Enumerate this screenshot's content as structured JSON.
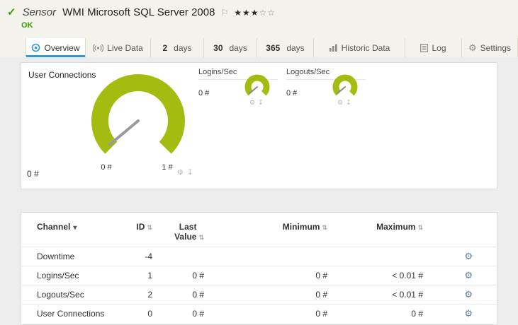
{
  "colors": {
    "gauge_green": "#a3bc0f",
    "needle_gray": "#999999",
    "tab_accent_blue": "#2d9bd8",
    "ok_green": "#30a000"
  },
  "icons": {
    "check": "✓",
    "flag": "⚐",
    "gear": "⚙",
    "download": "↧",
    "dropdown": "▾",
    "sort": "⇅",
    "channel_settings": "⚙"
  },
  "header": {
    "kind_label": "Sensor",
    "title": "WMI Microsoft SQL Server 2008",
    "stars_filled": "★★★",
    "stars_empty": "☆☆",
    "status": "OK"
  },
  "tabs": [
    {
      "label": "Overview"
    },
    {
      "label": "Live Data"
    },
    {
      "num": "2",
      "unit": "days"
    },
    {
      "num": "30",
      "unit": "days"
    },
    {
      "num": "365",
      "unit": "days"
    },
    {
      "label": "Historic Data"
    },
    {
      "label": "Log"
    },
    {
      "label": "Settings"
    }
  ],
  "gauge_panel": {
    "main": {
      "title": "User Connections",
      "value": "0 #",
      "scale_min": "0 #",
      "scale_max": "1 #"
    },
    "minis": [
      {
        "title": "Logins/Sec",
        "value": "0 #"
      },
      {
        "title": "Logouts/Sec",
        "value": "0 #"
      }
    ]
  },
  "channel_table": {
    "headers": {
      "channel": "Channel",
      "id": "ID",
      "last_value": "Last Value",
      "minimum": "Minimum",
      "maximum": "Maximum"
    },
    "rows": [
      {
        "channel": "Downtime",
        "id": "-4",
        "last_value": "",
        "minimum": "",
        "maximum": ""
      },
      {
        "channel": "Logins/Sec",
        "id": "1",
        "last_value": "0 #",
        "minimum": "0 #",
        "maximum": "< 0.01 #"
      },
      {
        "channel": "Logouts/Sec",
        "id": "2",
        "last_value": "0 #",
        "minimum": "0 #",
        "maximum": "< 0.01 #"
      },
      {
        "channel": "User Connections",
        "id": "0",
        "last_value": "0 #",
        "minimum": "0 #",
        "maximum": "0 #"
      }
    ]
  }
}
